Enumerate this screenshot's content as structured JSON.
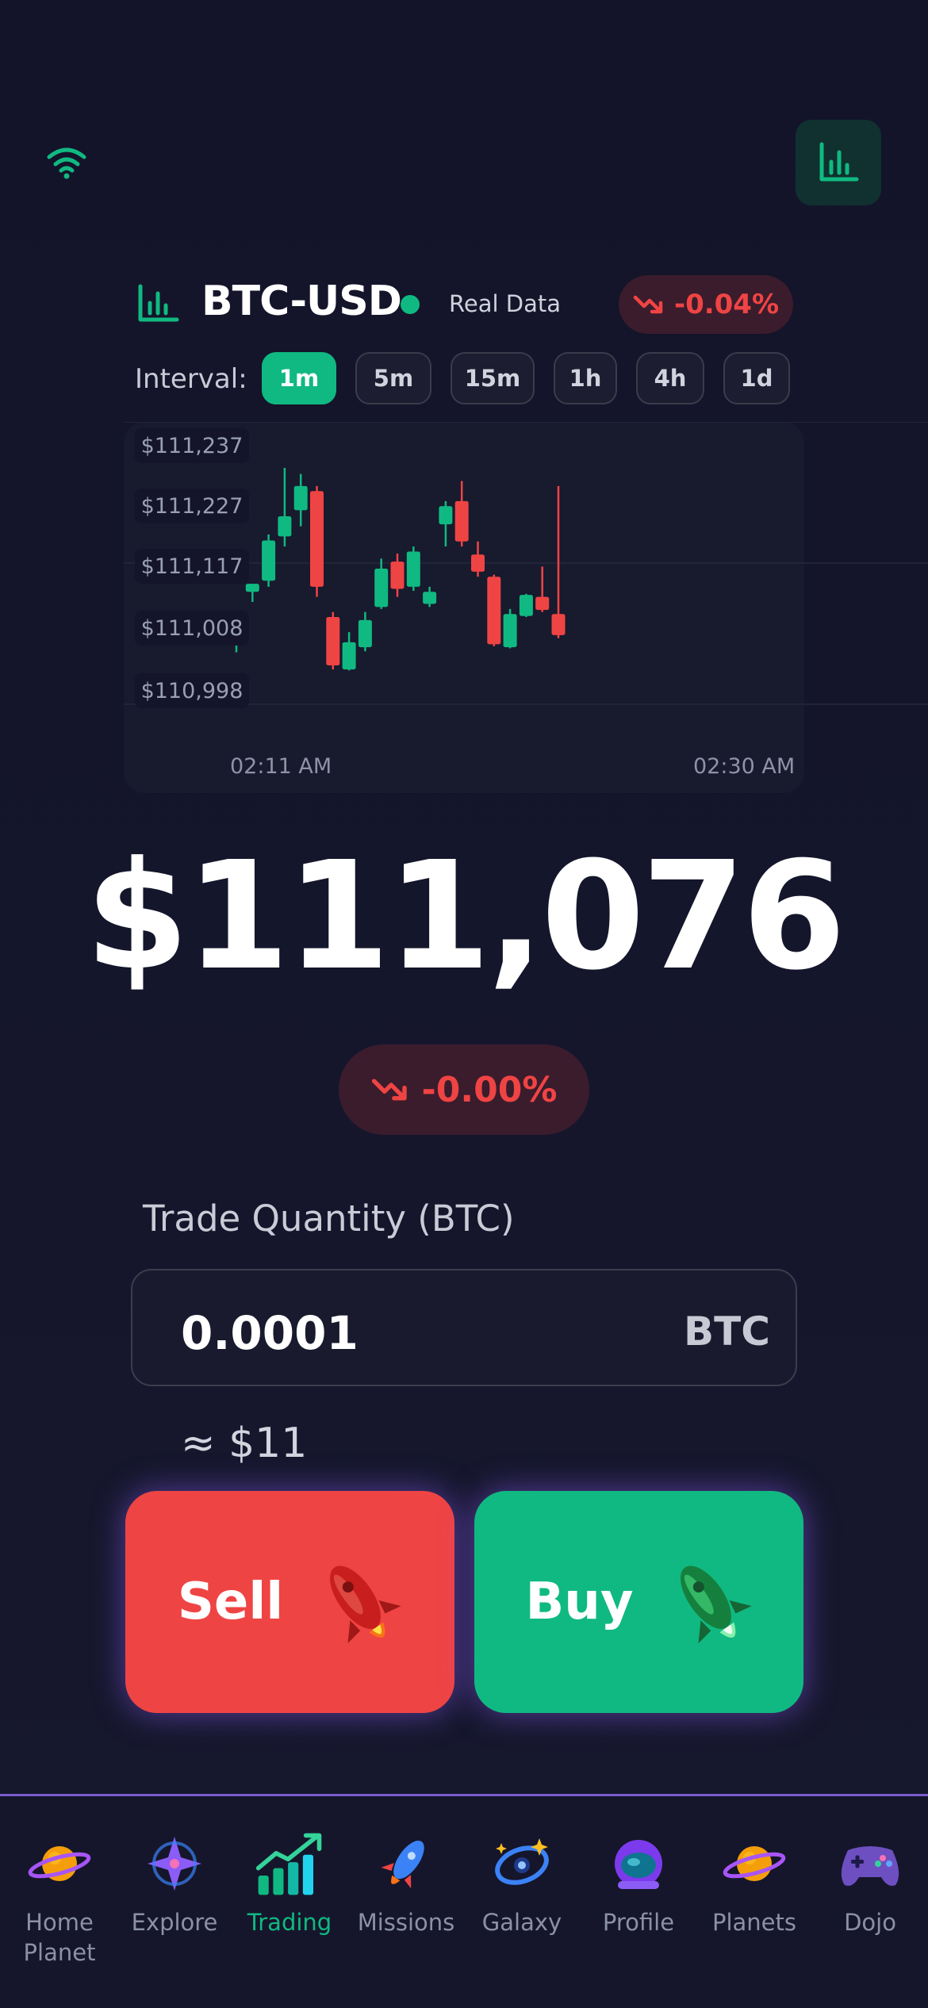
{
  "top": {
    "wifi_icon": "wifi-icon",
    "chart_icon": "bar-chart-icon"
  },
  "header": {
    "pair": "BTC-USD",
    "status": "Real Data",
    "change": "-0.04%",
    "change_color": "#ef4444",
    "accent": "#10b981"
  },
  "interval": {
    "label": "Interval:",
    "options": [
      "1m",
      "5m",
      "15m",
      "1h",
      "4h",
      "1d"
    ],
    "selected": "1m"
  },
  "chart_data": {
    "type": "candlestick",
    "y_ticks": [
      "$111,237",
      "$111,227",
      "$111,117",
      "$111,008",
      "$110,998"
    ],
    "x_ticks": [
      "02:11 AM",
      "02:30 AM"
    ],
    "candles": [
      {
        "o": 111047,
        "h": 111071,
        "l": 111035,
        "c": 111065
      },
      {
        "o": 111095,
        "h": 111102,
        "l": 111085,
        "c": 111103
      },
      {
        "o": 111106,
        "h": 111152,
        "l": 111100,
        "c": 111146
      },
      {
        "o": 111150,
        "h": 111218,
        "l": 111140,
        "c": 111170
      },
      {
        "o": 111176,
        "h": 111212,
        "l": 111160,
        "c": 111200
      },
      {
        "o": 111195,
        "h": 111200,
        "l": 111090,
        "c": 111100
      },
      {
        "o": 111070,
        "h": 111075,
        "l": 111018,
        "c": 111022
      },
      {
        "o": 111018,
        "h": 111055,
        "l": 111017,
        "c": 111045
      },
      {
        "o": 111040,
        "h": 111075,
        "l": 111036,
        "c": 111067
      },
      {
        "o": 111080,
        "h": 111128,
        "l": 111078,
        "c": 111118
      },
      {
        "o": 111125,
        "h": 111133,
        "l": 111090,
        "c": 111098
      },
      {
        "o": 111100,
        "h": 111140,
        "l": 111096,
        "c": 111135
      },
      {
        "o": 111083,
        "h": 111100,
        "l": 111080,
        "c": 111095
      },
      {
        "o": 111162,
        "h": 111185,
        "l": 111140,
        "c": 111180
      },
      {
        "o": 111185,
        "h": 111205,
        "l": 111140,
        "c": 111145
      },
      {
        "o": 111132,
        "h": 111145,
        "l": 111110,
        "c": 111115
      },
      {
        "o": 111110,
        "h": 111112,
        "l": 111041,
        "c": 111043
      },
      {
        "o": 111040,
        "h": 111078,
        "l": 111039,
        "c": 111073
      },
      {
        "o": 111071,
        "h": 111093,
        "l": 111070,
        "c": 111092
      },
      {
        "o": 111090,
        "h": 111120,
        "l": 111075,
        "c": 111077
      },
      {
        "o": 111073,
        "h": 111200,
        "l": 111049,
        "c": 111052
      }
    ],
    "up_color": "#10b981",
    "down_color": "#ef4444",
    "grid": true
  },
  "price": {
    "value": "$111,076",
    "change": "-0.00%"
  },
  "trade": {
    "label": "Trade Quantity (BTC)",
    "quantity": "0.0001",
    "unit": "BTC",
    "approx": "≈ $11",
    "sell_label": "Sell",
    "buy_label": "Buy",
    "sell_color": "#ef4444",
    "buy_color": "#10b981"
  },
  "nav": {
    "items": [
      {
        "label": "Home Planet",
        "icon": "ringed-planet-icon"
      },
      {
        "label": "Explore",
        "icon": "star-compass-icon"
      },
      {
        "label": "Trading",
        "icon": "chart-up-icon"
      },
      {
        "label": "Missions",
        "icon": "rocket-icon"
      },
      {
        "label": "Galaxy",
        "icon": "galaxy-icon"
      },
      {
        "label": "Profile",
        "icon": "astronaut-icon"
      },
      {
        "label": "Planets",
        "icon": "planet-icon"
      },
      {
        "label": "Dojo",
        "icon": "gamepad-icon"
      }
    ],
    "active": "Trading"
  }
}
